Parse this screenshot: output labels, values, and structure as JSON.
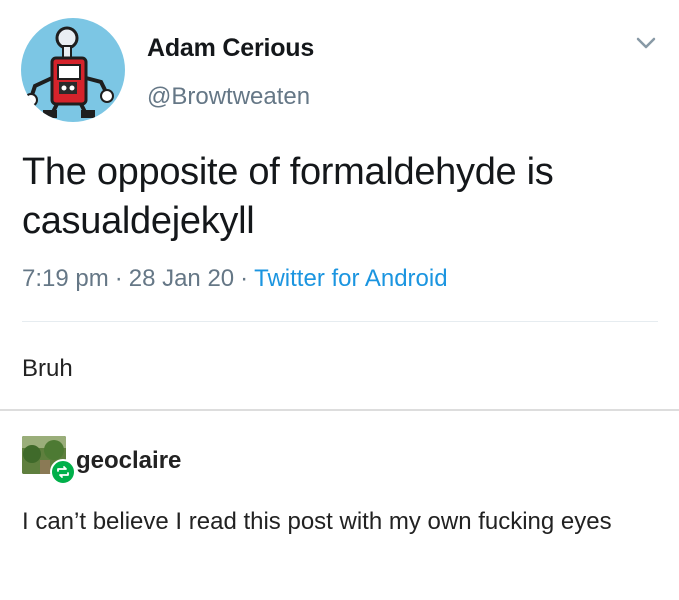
{
  "tweet": {
    "display_name": "Adam Cerious",
    "handle": "@Browtweaten",
    "text": "The opposite of formaldehyde is casualdejekyll",
    "time": "7:19 pm",
    "date": "28 Jan 20",
    "source": "Twitter for Android",
    "avatar_bg": "#7cc6e4",
    "link_color": "#1b95e0"
  },
  "post": {
    "comment": "Bruh"
  },
  "reblog": {
    "username": "geoclaire",
    "text": "I can’t believe I read this post with my own fucking eyes",
    "badge_color": "#00b04a"
  }
}
